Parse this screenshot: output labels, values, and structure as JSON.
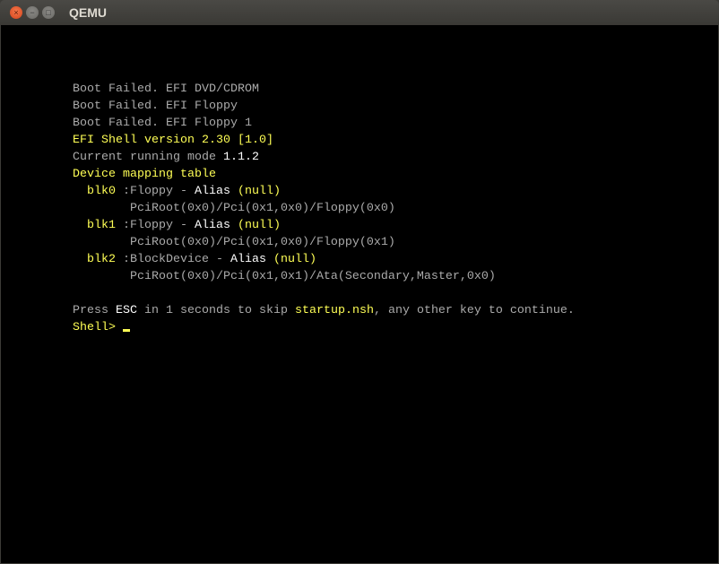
{
  "window": {
    "title": "QEMU",
    "close_icon": "×",
    "minimize_icon": "−",
    "maximize_icon": "□"
  },
  "colors": {
    "gray": "#aaaaaa",
    "yellow": "#ffff55",
    "white": "#ffffff"
  },
  "terminal": {
    "lines": [
      [
        {
          "t": "Boot Failed. EFI DVD/CDROM",
          "c": "g"
        }
      ],
      [
        {
          "t": "Boot Failed. EFI Floppy",
          "c": "g"
        }
      ],
      [
        {
          "t": "Boot Failed. EFI Floppy 1",
          "c": "g"
        }
      ],
      [
        {
          "t": "EFI Shell version 2.30 [1.0]",
          "c": "y"
        }
      ],
      [
        {
          "t": "Current running mode ",
          "c": "g"
        },
        {
          "t": "1.1.2",
          "c": "w"
        }
      ],
      [
        {
          "t": "Device mapping table",
          "c": "y"
        }
      ],
      [
        {
          "t": "  blk0 ",
          "c": "y"
        },
        {
          "t": ":Floppy - ",
          "c": "g"
        },
        {
          "t": "Alias ",
          "c": "w"
        },
        {
          "t": "(null)",
          "c": "y"
        }
      ],
      [
        {
          "t": "        PciRoot(0x0)/Pci(0x1,0x0)/Floppy(0x0)",
          "c": "g"
        }
      ],
      [
        {
          "t": "  blk1 ",
          "c": "y"
        },
        {
          "t": ":Floppy - ",
          "c": "g"
        },
        {
          "t": "Alias ",
          "c": "w"
        },
        {
          "t": "(null)",
          "c": "y"
        }
      ],
      [
        {
          "t": "        PciRoot(0x0)/Pci(0x1,0x0)/Floppy(0x1)",
          "c": "g"
        }
      ],
      [
        {
          "t": "  blk2 ",
          "c": "y"
        },
        {
          "t": ":BlockDevice - ",
          "c": "g"
        },
        {
          "t": "Alias ",
          "c": "w"
        },
        {
          "t": "(null)",
          "c": "y"
        }
      ],
      [
        {
          "t": "        PciRoot(0x0)/Pci(0x1,0x1)/Ata(Secondary,Master,0x0)",
          "c": "g"
        }
      ],
      [],
      [
        {
          "t": "Press ",
          "c": "g"
        },
        {
          "t": "ESC",
          "c": "w"
        },
        {
          "t": " in 1 seconds to skip ",
          "c": "g"
        },
        {
          "t": "startup.nsh",
          "c": "y"
        },
        {
          "t": ", any other key to continue.",
          "c": "g"
        }
      ]
    ],
    "prompt": "Shell> "
  }
}
